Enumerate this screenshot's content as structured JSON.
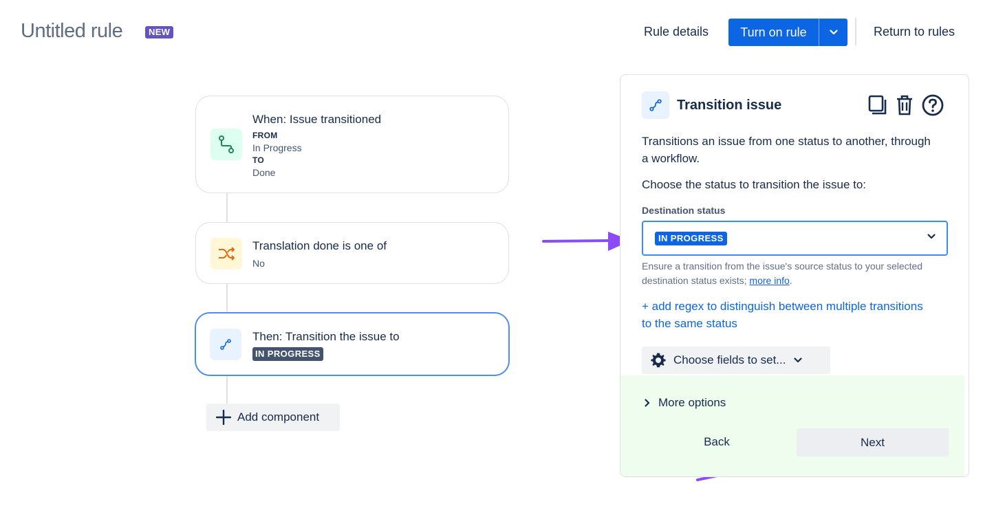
{
  "header": {
    "title": "Untitled rule",
    "badge": "NEW",
    "rule_details": "Rule details",
    "turn_on": "Turn on rule",
    "return": "Return to rules"
  },
  "flow": {
    "trigger": {
      "title": "When: Issue transitioned",
      "from_label": "FROM",
      "from_value": "In Progress",
      "to_label": "TO",
      "to_value": "Done"
    },
    "condition": {
      "title": "Translation done is one of",
      "value": "No"
    },
    "action": {
      "title": "Then: Transition the issue to",
      "status": "IN PROGRESS"
    },
    "add_component": "Add component"
  },
  "panel": {
    "title": "Transition issue",
    "description": "Transitions an issue from one status to another, through a workflow.",
    "choose_status": "Choose the status to transition the issue to:",
    "field_label": "Destination status",
    "selected_status": "IN PROGRESS",
    "help_text": "Ensure a transition from the issue's source status to your selected destination status exists; ",
    "help_link": "more info",
    "help_end": ".",
    "regex_link": "+ add regex to distinguish between multiple transitions to the same status",
    "choose_fields": "Choose fields to set...",
    "more_options": "More options",
    "back": "Back",
    "next": "Next"
  },
  "colors": {
    "primary": "#0c66e4",
    "badge": "#6554c0",
    "annotation_arrow": "#8b4cf7",
    "trigger_icon_bg": "#dcfff1",
    "condition_icon_bg": "#fff7d6",
    "action_icon_bg": "#e9f2ff",
    "footer_bg": "#eefded"
  },
  "icons": [
    "transition-icon",
    "branch-shuffle-icon",
    "duplicate-icon",
    "trash-icon",
    "help-icon",
    "chevron-down-icon",
    "plus-icon",
    "gear-icon",
    "chevron-right-icon"
  ]
}
